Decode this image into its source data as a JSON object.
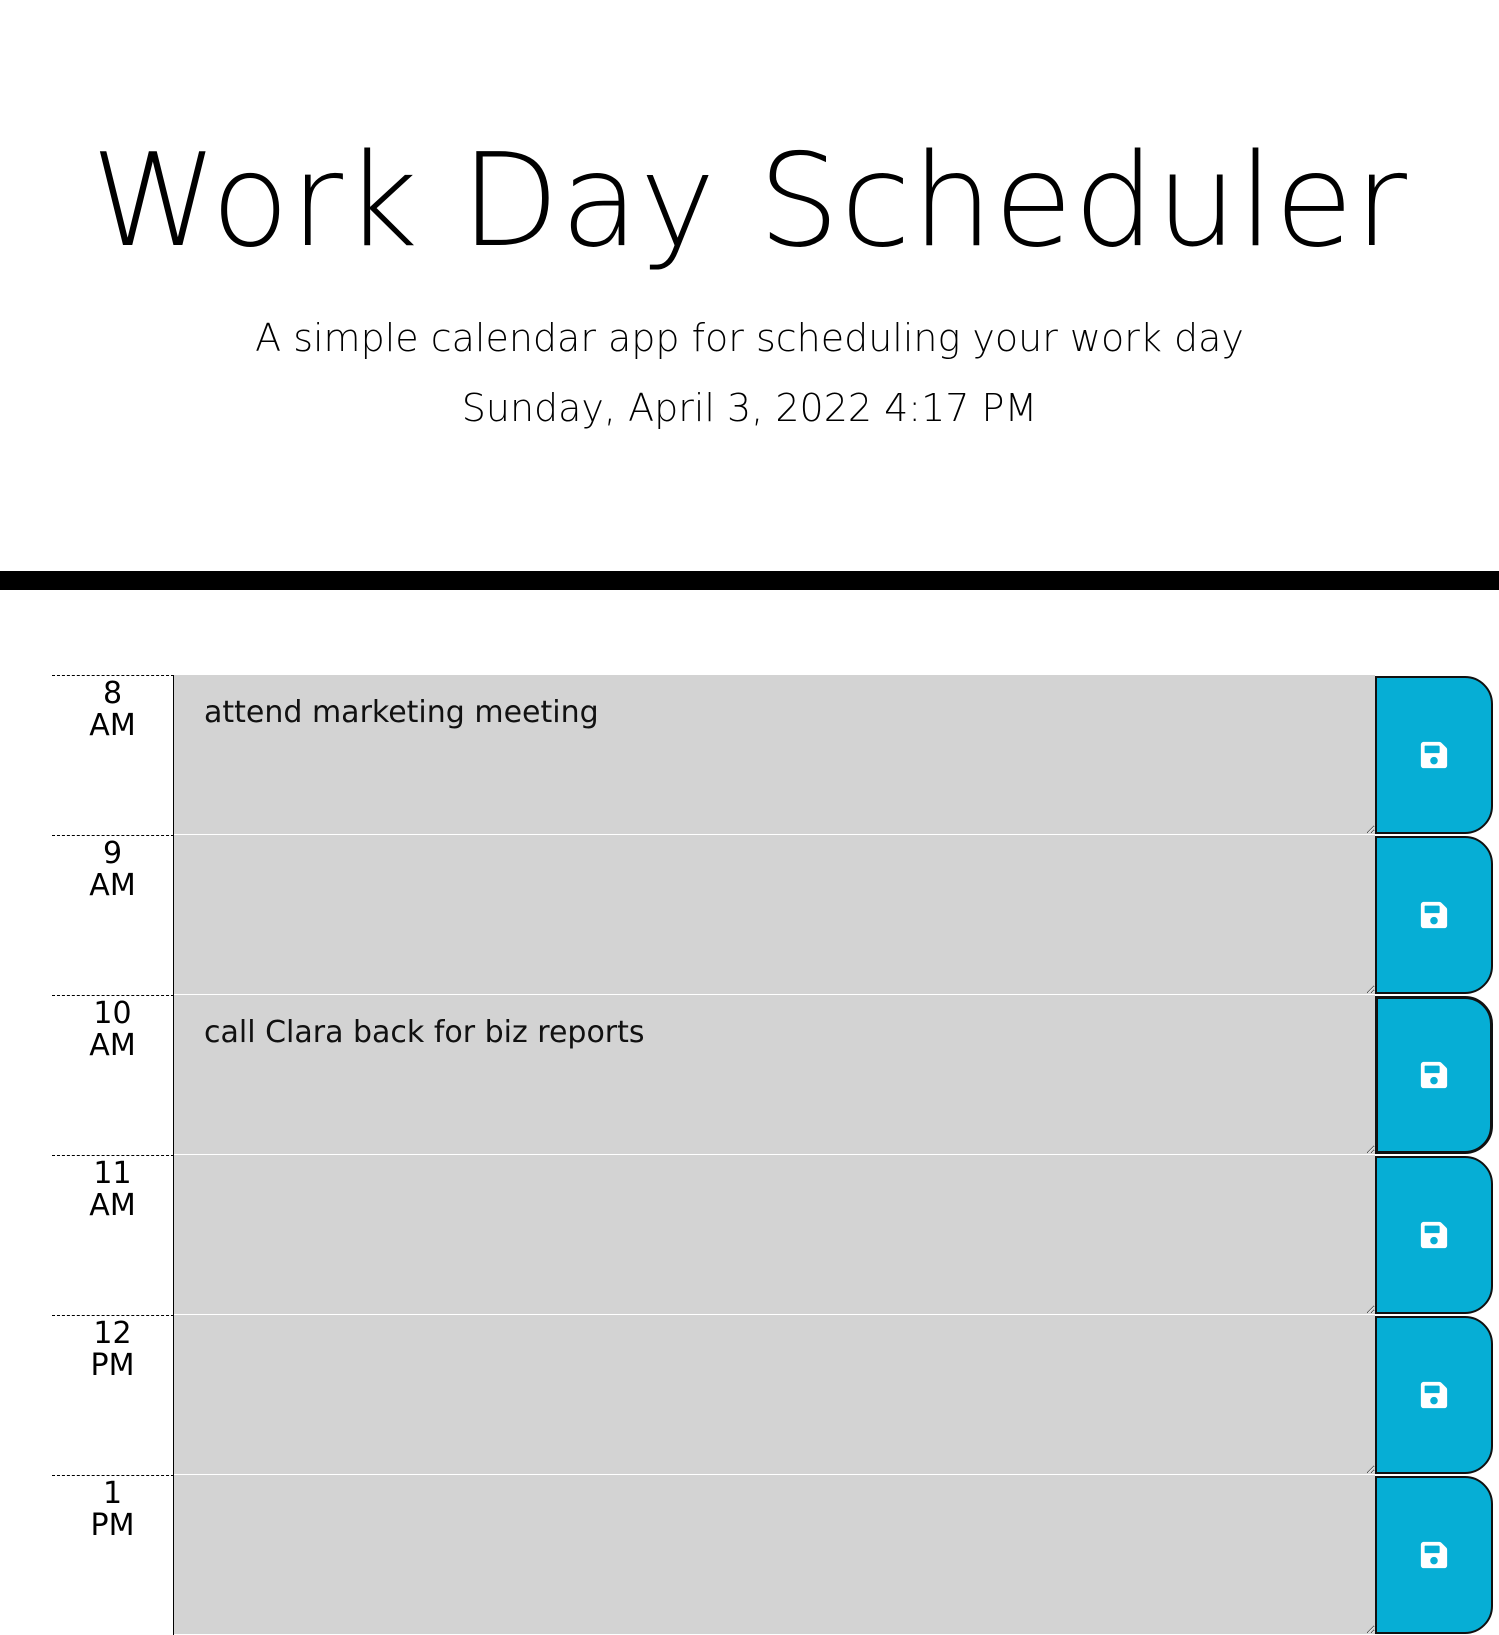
{
  "header": {
    "title": "Work Day Scheduler",
    "subtitle": "A simple calendar app for scheduling your work day",
    "current_day": "Sunday, April 3, 2022 4:17 PM"
  },
  "colors": {
    "past": "#d3d3d3",
    "save_button": "#06aed5",
    "divider": "#000000"
  },
  "rows": [
    {
      "hour_num": "8",
      "hour_period": "AM",
      "text": "attend marketing meeting",
      "save_icon": "floppy-disk-icon"
    },
    {
      "hour_num": "9",
      "hour_period": "AM",
      "text": "",
      "save_icon": "floppy-disk-icon"
    },
    {
      "hour_num": "10",
      "hour_period": "AM",
      "text": "call Clara back for biz reports",
      "save_icon": "floppy-disk-icon"
    },
    {
      "hour_num": "11",
      "hour_period": "AM",
      "text": "",
      "save_icon": "floppy-disk-icon"
    },
    {
      "hour_num": "12",
      "hour_period": "PM",
      "text": "",
      "save_icon": "floppy-disk-icon"
    },
    {
      "hour_num": "1",
      "hour_period": "PM",
      "text": "",
      "save_icon": "floppy-disk-icon"
    }
  ]
}
